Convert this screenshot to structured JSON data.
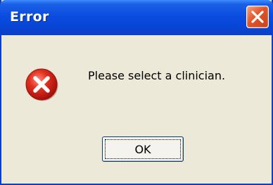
{
  "dialog": {
    "title": "Error",
    "message": "Please select a clinician.",
    "ok_label": "OK",
    "icon": "error-icon",
    "close_icon": "close-icon"
  },
  "colors": {
    "titlebar": "#0a4de0",
    "dialog_background": "#ece9d8",
    "close_button": "#e0552a",
    "error_icon": "#d8221a"
  }
}
